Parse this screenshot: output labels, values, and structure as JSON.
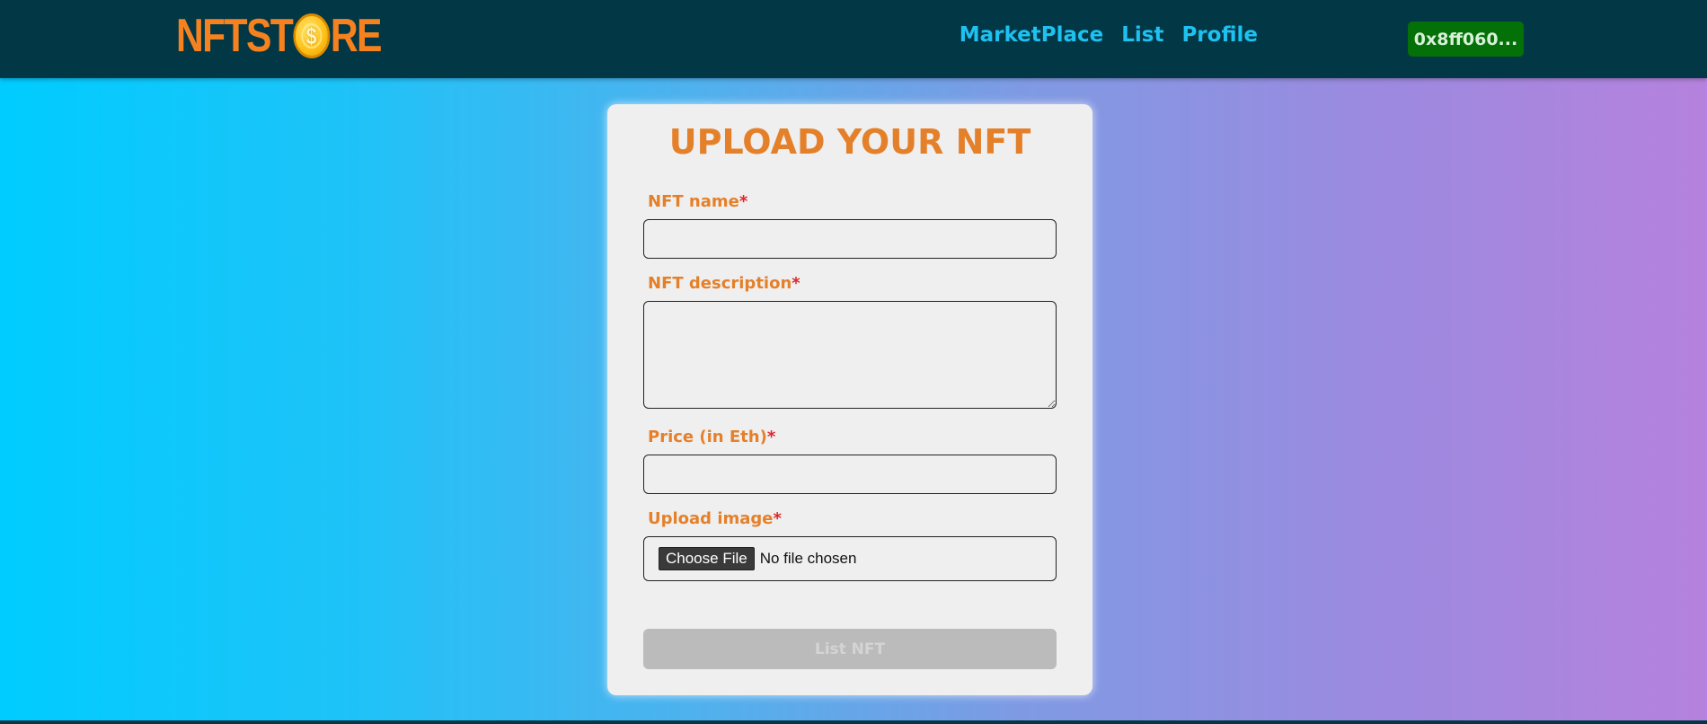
{
  "navbar": {
    "logo": {
      "text_left": "NFTST",
      "text_right": "RE",
      "coin_icon": "dollar-coin-icon"
    },
    "links": [
      {
        "label": "MarketPlace"
      },
      {
        "label": "List"
      },
      {
        "label": "Profile"
      }
    ],
    "wallet_label": "0x8ff060..."
  },
  "form": {
    "title": "UPLOAD YOUR NFT",
    "required_marker": "*",
    "name": {
      "label": "NFT name",
      "value": "",
      "placeholder": ""
    },
    "description": {
      "label": "NFT description",
      "value": "",
      "placeholder": ""
    },
    "price": {
      "label": "Price (in Eth)",
      "value": "",
      "placeholder": ""
    },
    "image": {
      "label": "Upload image",
      "button_label": "Choose File",
      "status": "No file chosen"
    },
    "submit_label": "List NFT"
  },
  "colors": {
    "navbar_bg": "#023746",
    "accent_orange": "#e5802a",
    "nav_link": "#1ec1f0",
    "wallet_bg": "#047008",
    "required_red": "#e0242a",
    "background_gradient": [
      "#00ccff",
      "#b582dd"
    ]
  }
}
